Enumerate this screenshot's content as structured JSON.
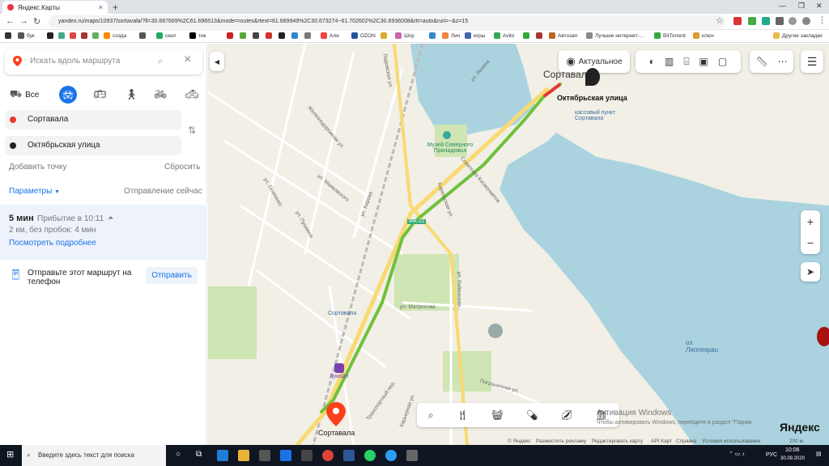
{
  "browser": {
    "tab_title": "Яндекс.Карты",
    "url": "yandex.ru/maps/10937/sortavala/?ll=30.687669%2C61.696513&mode=routes&rtext=61.689949%2C30.673274~61.702602%2C30.6936008&rtt=auto&ruri=~&z=15",
    "bookmarks": [
      "бук",
      "созда",
      "скил",
      "тик",
      "Али",
      "OZON",
      "Шоу",
      "Лич",
      "игры",
      "Avito",
      "Автозап",
      "Лучшие интернет-...",
      "BitTorrent",
      "ключ"
    ],
    "other_bookmarks": "Другие закладки"
  },
  "sidebar": {
    "search_placeholder": "Искать вдоль маршрута",
    "modes": {
      "all_label": "Все"
    },
    "from": "Сортавала",
    "to": "Октябрьская улица",
    "add_point": "Добавить точку",
    "reset": "Сбросить",
    "params": "Параметры",
    "departure": "Отправление сейчас",
    "route": {
      "duration": "5 мин",
      "arrival": "Прибытие в 10:11",
      "details": "2 км, без пробок: 4 мин",
      "more": "Посмотреть подробнее"
    },
    "send": {
      "text": "Отправьте этот маршрут на телефон",
      "button": "Отправить"
    }
  },
  "map": {
    "actual": "Актуальное",
    "labels": {
      "city_top": "Сортавала",
      "destination": "Октябрьская улица",
      "ticket": "кассовый пункт Сортавала",
      "museum": "Музей Северного Приладожья",
      "start": "Сортавала",
      "lake": "оз. Ляппяярви",
      "bus": "Сортавала",
      "lukoil": "Лукойл",
      "road": "86К-21"
    },
    "streets": [
      "Ладожская ул.",
      "ул. Ленина",
      "Железнодорожная ул.",
      "ул. Маяковского",
      "ул. Кирова",
      "Карельская ул.",
      "Советских Космонавтов",
      "ул. Кайманова",
      "ул. Матросова",
      "Пограничная ул.",
      "ул. Осипенко",
      "ул. Пушкина",
      "Транспортный пер.",
      "Карьерная ул."
    ],
    "zoom_in": "+",
    "zoom_out": "−",
    "footer": [
      "© Яндекс",
      "Разместить рекламу",
      "Редактировать карту",
      "API Карт",
      "Справка",
      "Условия использования"
    ],
    "scale": "200 м",
    "brand": "Яндекс",
    "activation": "Активация Windows",
    "activation_sub": "Чтобы активировать Windows, перейдите в раздел \"Парам"
  },
  "taskbar": {
    "search": "Введите здесь текст для поиска",
    "lang": "РУС",
    "time": "10:06",
    "date": "30.09.2020"
  }
}
